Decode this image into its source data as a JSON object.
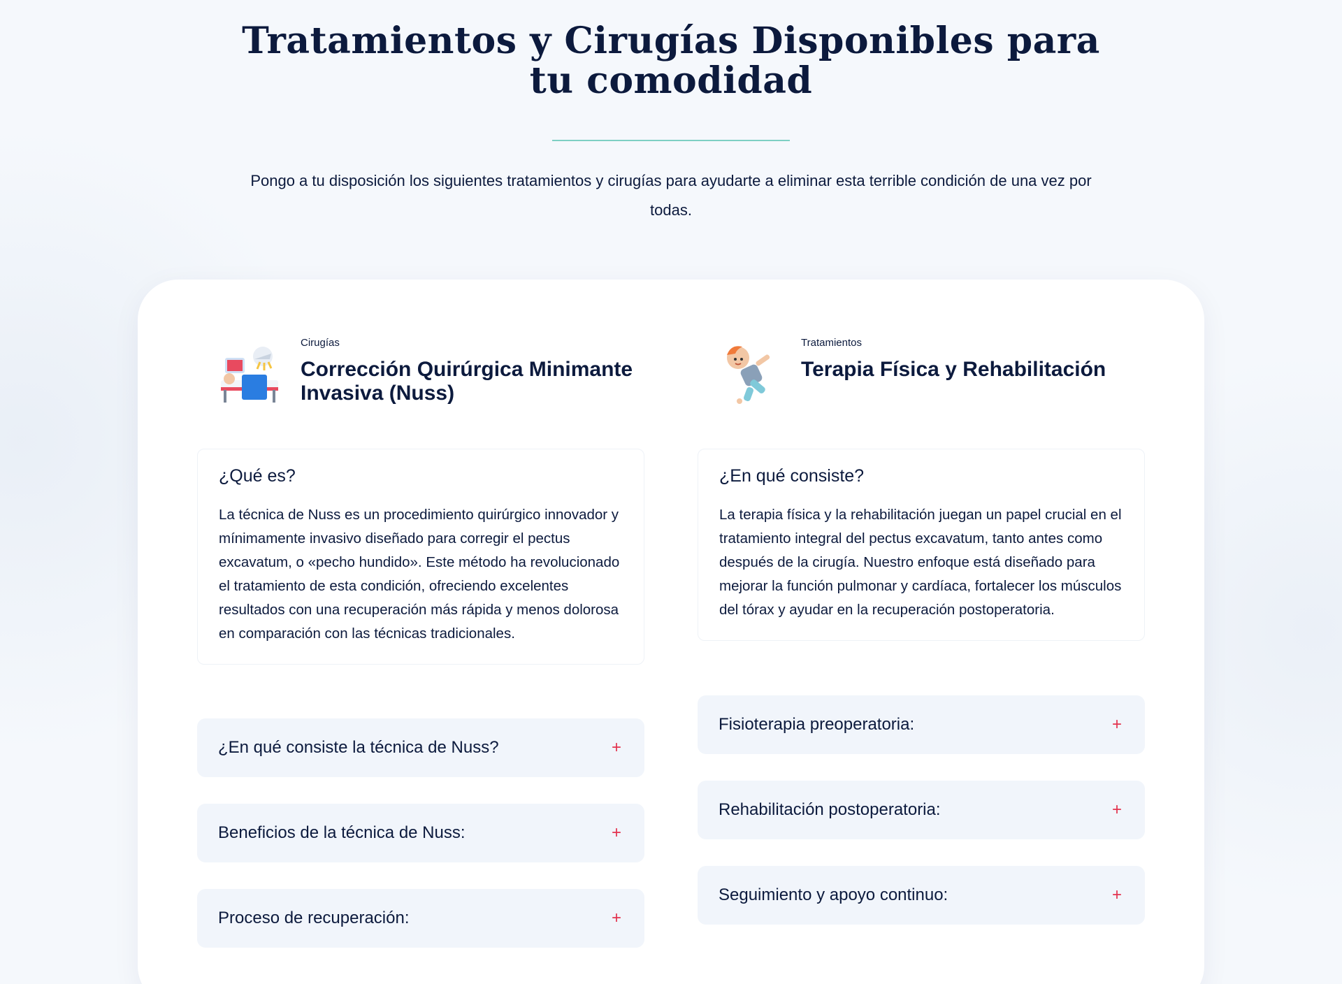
{
  "section": {
    "title_line1": "Tratamientos y Cirugías Disponibles para",
    "title_line2": "tu comodidad",
    "intro": "Pongo a tu disposición los siguientes tratamientos y cirugías para ayudarte a eliminar esta terrible condición de una vez por todas."
  },
  "colors": {
    "accent_plus": "#e3334f",
    "divider": "#7ed0c4",
    "text": "#0c1a3d",
    "accordion_bg": "#f1f5fb"
  },
  "left": {
    "icon": "surgery-icon",
    "eyebrow": "Cirugías",
    "title": "Corrección Quirúrgica Minimante Invasiva (Nuss)",
    "info_title": "¿Qué es?",
    "info_text": "La técnica de Nuss es un procedimiento quirúrgico innovador y mínimamente invasivo diseñado para corregir el pectus excavatum, o «pecho hundido». Este método ha revolucionado el tratamiento de esta condición, ofreciendo excelentes resultados con una recuperación más rápida y menos dolorosa en comparación con las técnicas tradicionales.",
    "accordions": [
      {
        "label": "¿En qué consiste la técnica de Nuss?",
        "toggle": "+"
      },
      {
        "label": "Beneficios de la técnica de Nuss:",
        "toggle": "+"
      },
      {
        "label": "Proceso de recuperación:",
        "toggle": "+"
      }
    ]
  },
  "right": {
    "icon": "physiotherapy-child-icon",
    "eyebrow": "Tratamientos",
    "title": "Terapia Física y Rehabilitación",
    "info_title": "¿En qué consiste?",
    "info_text": "La terapia física y la rehabilitación juegan un papel crucial en el tratamiento integral del pectus excavatum, tanto antes como después de la cirugía. Nuestro enfoque está diseñado para mejorar la función pulmonar y cardíaca, fortalecer los músculos del tórax y ayudar en la recuperación postoperatoria.",
    "accordions": [
      {
        "label": "Fisioterapia preoperatoria:",
        "toggle": "+"
      },
      {
        "label": "Rehabilitación postoperatoria:",
        "toggle": "+"
      },
      {
        "label": "Seguimiento y apoyo continuo:",
        "toggle": "+"
      }
    ]
  }
}
